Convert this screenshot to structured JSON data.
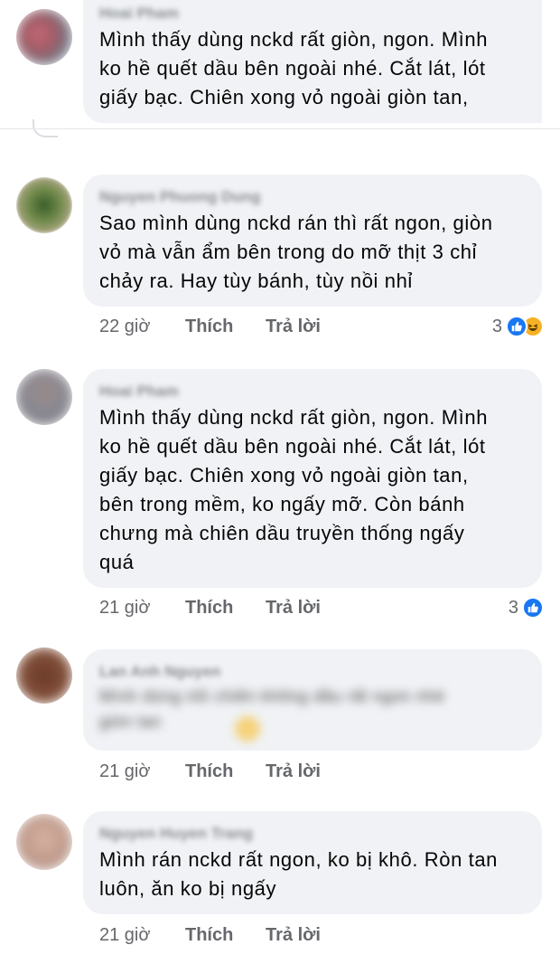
{
  "comments": [
    {
      "author": "Hoai Pham",
      "text_lines": [
        "Mình thấy dùng nckd rất giòn, ngon. Mình",
        "ko hề quết dầu bên ngoài nhé. Cắt lát, lót",
        "giấy bạc. Chiên xong vỏ ngoài giòn tan,"
      ]
    },
    {
      "author": "Nguyen Phuong Dung",
      "text_lines": [
        "Sao mình dùng nckd rán thì rất ngon, giòn",
        "vỏ mà vẫn ẩm bên trong do mỡ thịt 3 chỉ",
        "chảy ra. Hay tùy bánh, tùy nồi nhỉ"
      ],
      "time": "22 giờ",
      "like": "Thích",
      "reply": "Trả lời",
      "reactions": "3"
    },
    {
      "author": "Hoai Pham",
      "text_lines": [
        "Mình thấy dùng nckd rất giòn, ngon. Mình",
        "ko hề quết dầu bên ngoài nhé. Cắt lát, lót",
        "giấy bạc. Chiên xong vỏ ngoài giòn tan,",
        "bên trong mềm, ko ngấy mỡ. Còn bánh",
        "chưng mà chiên dầu truyền thống ngấy",
        "quá"
      ],
      "time": "21 giờ",
      "like": "Thích",
      "reply": "Trả lời",
      "reactions": "3"
    },
    {
      "author": "Lan Anh Nguyen",
      "text_lines": [
        "Mình dùng nồi chiên không dầu rất ngon nhé",
        "giòn tan"
      ],
      "time": "21 giờ",
      "like": "Thích",
      "reply": "Trả lời"
    },
    {
      "author": "Nguyen Huyen Trang",
      "text_lines": [
        "Mình rán nckd rất ngon, ko bị khô. Ròn tan",
        "luôn, ăn ko bị ngấy"
      ],
      "time": "21 giờ",
      "like": "Thích",
      "reply": "Trả lời"
    }
  ],
  "colors": {
    "bubble": "#f0f2f5",
    "meta": "#65676b",
    "like_blue": "#1877f2",
    "haha_yellow": "#f7b125"
  }
}
